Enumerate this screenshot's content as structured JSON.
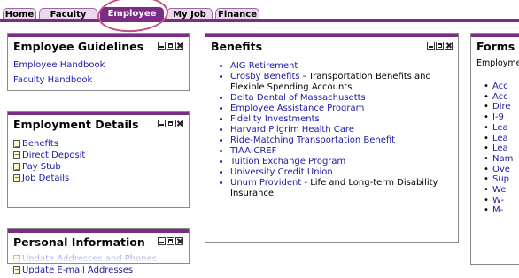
{
  "tabs": [
    {
      "label": "Home"
    },
    {
      "label": "Faculty"
    },
    {
      "label": "Employee"
    },
    {
      "label": "My Job"
    },
    {
      "label": "Finance"
    }
  ],
  "guidelines": {
    "title": "Employee Guidelines",
    "links": [
      "Employee Handbook",
      "Faculty Handbook"
    ]
  },
  "employment": {
    "title": "Employment Details",
    "items": [
      "Benefits",
      "Direct Deposit",
      "Pay Stub",
      "Job Details"
    ]
  },
  "personal": {
    "title": "Personal Information",
    "items": [
      "Update Addresses and Phones",
      "Update E-mail Addresses"
    ]
  },
  "benefits": {
    "title": "Benefits",
    "items": [
      {
        "link": "AIG Retirement",
        "desc": ""
      },
      {
        "link": "Crosby Benefits",
        "desc": " - Transportation Benefits and Flexible Spending Accounts"
      },
      {
        "link": "Delta Dental of Massachusetts",
        "desc": ""
      },
      {
        "link": "Employee Assistance Program",
        "desc": ""
      },
      {
        "link": "Fidelity Investments",
        "desc": ""
      },
      {
        "link": "Harvard Pilgrim Health Care",
        "desc": ""
      },
      {
        "link": "Ride-Matching Transportation Benefit",
        "desc": ""
      },
      {
        "link": "TIAA-CREF",
        "desc": ""
      },
      {
        "link": "Tuition Exchange Program",
        "desc": ""
      },
      {
        "link": "University Credit Union",
        "desc": ""
      },
      {
        "link": "Unum Provident",
        "desc": " - Life and Long-term Disability Insurance"
      }
    ]
  },
  "forms": {
    "title": "Forms",
    "subtitle": "Employme",
    "items": [
      "Acc",
      "Acc",
      "Dire",
      "I-9",
      "Lea",
      "Lea",
      "Lea",
      "Nam",
      "Ove",
      "Sup",
      "We",
      "W-",
      "M-"
    ]
  }
}
